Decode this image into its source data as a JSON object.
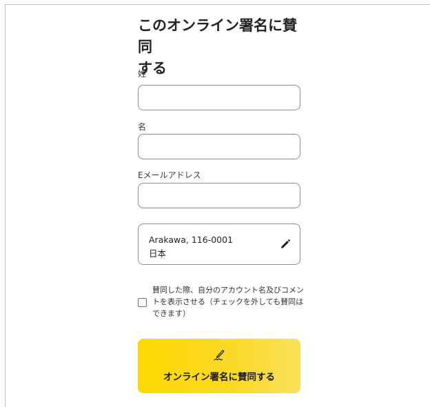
{
  "form": {
    "title_line1": "このオンライン署名に賛同",
    "title_line2": "する",
    "last_name_label": "姓",
    "last_name_value": "",
    "first_name_label": "名",
    "first_name_value": "",
    "email_label": "Eメールアドレス",
    "email_value": "",
    "location": {
      "line1": "Arakawa, 116-0001",
      "line2": "日本",
      "edit_icon": "pencil-icon"
    },
    "consent": {
      "checked": false,
      "text": "賛同した際、自分のアカウント名及びコメントを表示させる（チェックを外しても賛同はできます）"
    },
    "submit": {
      "icon": "signature-pen-icon",
      "label": "オンライン署名に賛同する"
    }
  },
  "colors": {
    "button_start": "#ffd900",
    "button_end": "#f7e15a",
    "border": "#8c8c8c"
  }
}
